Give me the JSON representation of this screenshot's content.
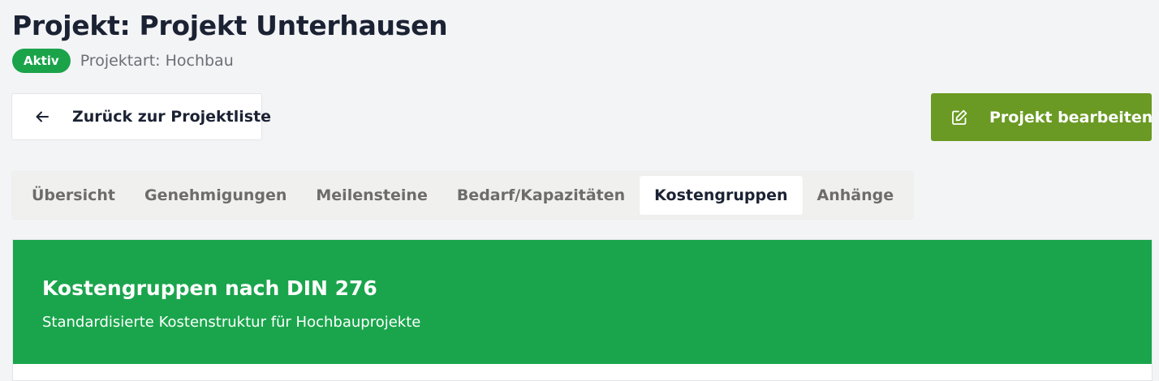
{
  "header": {
    "title": "Projekt: Projekt Unterhausen",
    "status_badge": "Aktiv",
    "project_type": "Projektart: Hochbau"
  },
  "actions": {
    "back_label": "Zurück zur Projektliste",
    "back_icon": "arrow-left-icon",
    "edit_label": "Projekt bearbeiten",
    "edit_icon": "edit-icon"
  },
  "tabs": [
    {
      "label": "Übersicht",
      "active": false
    },
    {
      "label": "Genehmigungen",
      "active": false
    },
    {
      "label": "Meilensteine",
      "active": false
    },
    {
      "label": "Bedarf/Kapazitäten",
      "active": false
    },
    {
      "label": "Kostengruppen",
      "active": true
    },
    {
      "label": "Anhänge",
      "active": false
    }
  ],
  "cost_groups": {
    "title": "Kostengruppen nach DIN 276",
    "subtitle": "Standardisierte Kostenstruktur für Hochbauprojekte"
  },
  "colors": {
    "background": "#f3f4f6",
    "status_green": "#1ba34a",
    "edit_button": "#6a9a23",
    "panel_header": "#1aa54c"
  }
}
